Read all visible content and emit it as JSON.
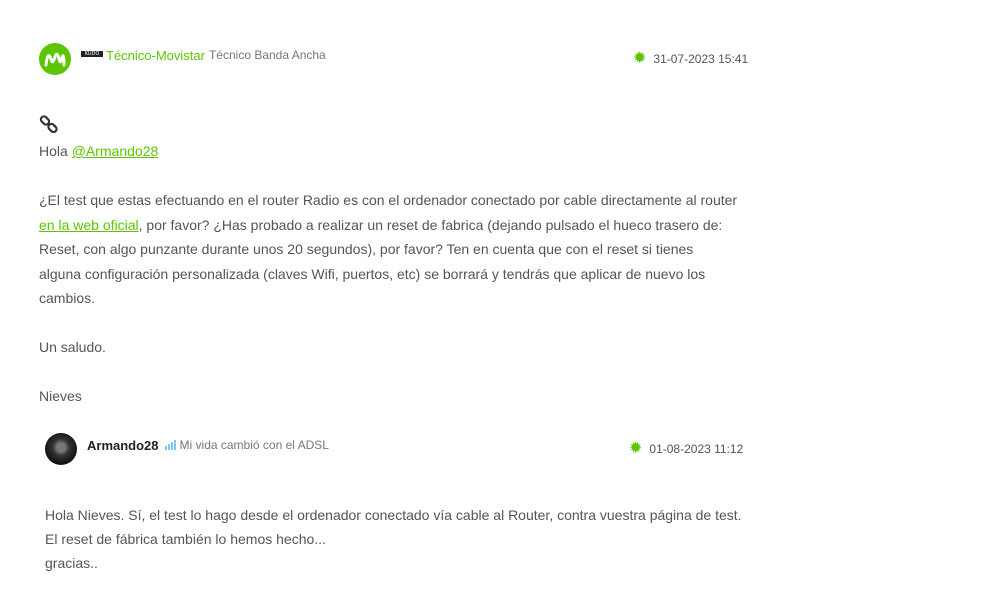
{
  "post1": {
    "username": "Técnico-Movistar",
    "badge_text": "KUDO",
    "rank": "Técnico Banda Ancha",
    "date": "31-07-2023 15:41",
    "greeting_prefix": "Hola ",
    "mention": "@Armando28",
    "p1_a": "¿El test que estas efectuando en el router Radio es con el ordenador conectado por cable directamente al router ",
    "p1_link": "en la web oficial",
    "p1_b": ", por favor? ¿Has probado a realizar un reset de fabrica (dejando pulsado el hueco trasero de: Reset, con algo punzante durante unos 20 segundos), por favor? Ten en cuenta que con el reset si tienes alguna configuración personalizada (claves Wifi, puertos, etc) se borrará y tendrás que aplicar de nuevo los cambios.",
    "closing": "Un saludo.",
    "signature": "Nieves"
  },
  "post2": {
    "username": "Armando28",
    "rank": "Mi vida cambió con el ADSL",
    "date": "01-08-2023 11:12",
    "lines": [
      "Hola Nieves. Sí, el test lo hago desde el ordenador conectado vía cable al Router, contra vuestra página de test.",
      "El reset de fábrica también lo hemos hecho...",
      "gracias.."
    ]
  },
  "icons": {
    "brand_avatar": "movistar-logo-icon",
    "link": "chain-link-icon",
    "date": "gear-icon",
    "rank_signal": "signal-bars-icon"
  },
  "colors": {
    "accent": "#5bc500",
    "text": "#555555",
    "signal": "#7fc6f2"
  }
}
